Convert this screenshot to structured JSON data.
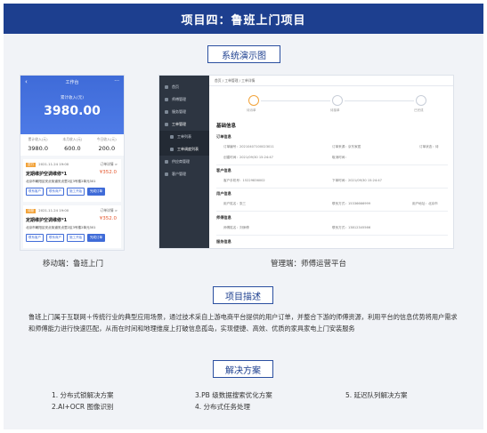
{
  "header": {
    "title": "项目四：鲁班上门项目"
  },
  "demo": {
    "label": "系统演示图",
    "mobile_caption": "移动端：鲁班上门",
    "desktop_caption": "管理端：师傅运营平台",
    "mobile": {
      "title": "工作台",
      "back_icon": "‹",
      "more_icon": "···",
      "amount_label": "累计收入(元)",
      "amount": "3980.00",
      "stats": [
        {
          "label": "累计收入(元)",
          "value": "3980.0"
        },
        {
          "label": "本月收入(元)",
          "value": "600.0"
        },
        {
          "label": "今日收入(元)",
          "value": "200.0"
        }
      ],
      "orders": [
        {
          "tag": "进行",
          "time": "2021.11.24 19:00",
          "status": "订单详情 >",
          "title": "定期维护空调维修*1",
          "price": "¥352.0",
          "addr": "北京市朝阳区安贞街道安贞里2区3号楼2单元301",
          "btns": [
            "联系客户",
            "联系商户",
            "施工开始",
            "完成订单"
          ]
        },
        {
          "tag": "待服",
          "time": "2021.11.24 19:00",
          "status": "订单详情 >",
          "title": "定期维护空调维修*1",
          "price": "¥352.0",
          "addr": "北京市朝阳区安贞街道安贞里2区3号楼2单元301",
          "btns": [
            "联系客户",
            "联系商户",
            "施工开始",
            "完成订单"
          ]
        }
      ]
    },
    "desktop": {
      "breadcrumb": "首页 / 工单管理 / 工单详情",
      "sidebar": [
        "首页",
        "师傅管理",
        "服务管理",
        "工单管理",
        "工单列表",
        "工单调度列表",
        "供应商管理",
        "客户管理"
      ],
      "steps": [
        "待派单",
        "待接单",
        "已完成"
      ],
      "title": "基础信息",
      "sections": [
        {
          "name": "订单信息",
          "fields": [
            "订单编号：20210407100023011",
            "订单来源：京东家居",
            "订单状态：待",
            "创建时间：2021/09/30 15:24:47",
            "取消时间："
          ]
        },
        {
          "name": "客户信息",
          "fields": [
            "客户手机号：15229836002",
            "下单时间：2021/09/30 15:24:47"
          ]
        },
        {
          "name": "用户信息",
          "fields": [
            "用户姓名：张三",
            "联系方式：15336666999",
            "用户地址：北京市"
          ]
        },
        {
          "name": "师傅信息",
          "fields": [
            "师傅姓名：刘师傅",
            "联系方式：13812345566"
          ]
        },
        {
          "name": "服务信息",
          "fields": []
        }
      ]
    }
  },
  "description": {
    "label": "项目描述",
    "text": "鲁班上门属于互联网＋传统行业的典型应用场景，通过技术采自上游电商平台提供的用户订单，并整合下游的师傅资源，利用平台的信息优势将用户需求和师傅能力进行快速匹配，从而在时间和地理维度上打破信息孤岛，实现便捷、高效、优质的家具家电上门安装服务"
  },
  "solutions": {
    "label": "解决方案",
    "items": [
      "1. 分布式锁解决方案",
      "2.AI+OCR 图像识别",
      "3.PB 级数据搜索优化方案",
      "4. 分布式任务处理",
      "5. 延迟队列解决方案"
    ]
  },
  "colors": {
    "banner": "#1d3f8f",
    "accent": "#3f6bd8",
    "panel": "#f1f3f7",
    "price": "#e4572e"
  }
}
